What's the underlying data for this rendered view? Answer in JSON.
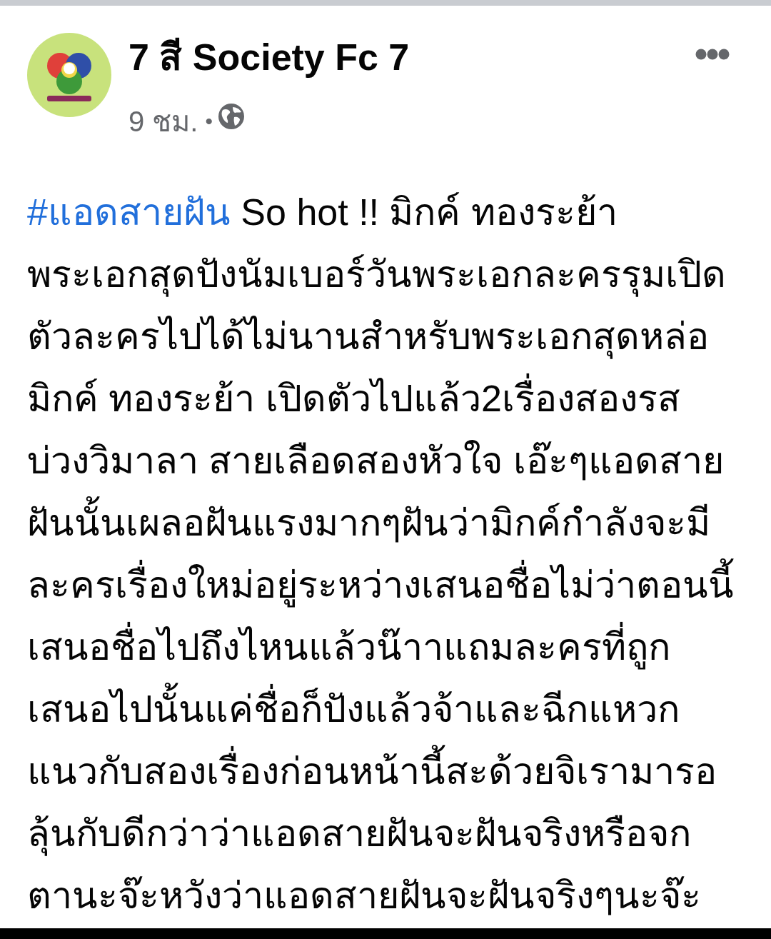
{
  "post": {
    "author": "7 สี Society Fc 7",
    "time": "9 ชม.",
    "separator": "•",
    "hashtag": "#แอดสายฝัน",
    "lines": [
      "So hot !! มิกค์ ทองระย้า",
      "พระเอกสุดปังนัมเบอร์วันพระเอกละครรุมเปิด",
      "ตัวละครไปได้ไม่นานสำหรับพระเอกสุดหล่อ",
      "มิกค์ ทองระย้า เปิดตัวไปแล้ว2เรื่องสองรส",
      "บ่วงวิมาลา สายเลือดสองหัวใจ เอ๊ะๆแอดสาย",
      "ฝันนั้นเผลอฝันแรงมากๆฝันว่ามิกค์กำลังจะมี",
      "ละครเรื่องใหม่อยู่ระหว่างเสนอชื่อไม่ว่าตอนนี้",
      "เสนอชื่อไปถึงไหนแล้วน๊าาแถมละครที่ถูก",
      "เสนอไปนั้นแค่ชื่อก็ปังแล้วจ้าและฉีกแหวก",
      "แนวกับสองเรื่องก่อนหน้านี้สะด้วยจิเรามารอ",
      "ลุ้นกับดีกว่าว่าแอดสายฝันจะฝันจริงหรือจก",
      "ตานะจ๊ะหวังว่าแอดสายฝันจะฝันจริงๆนะจ๊ะ"
    ]
  }
}
